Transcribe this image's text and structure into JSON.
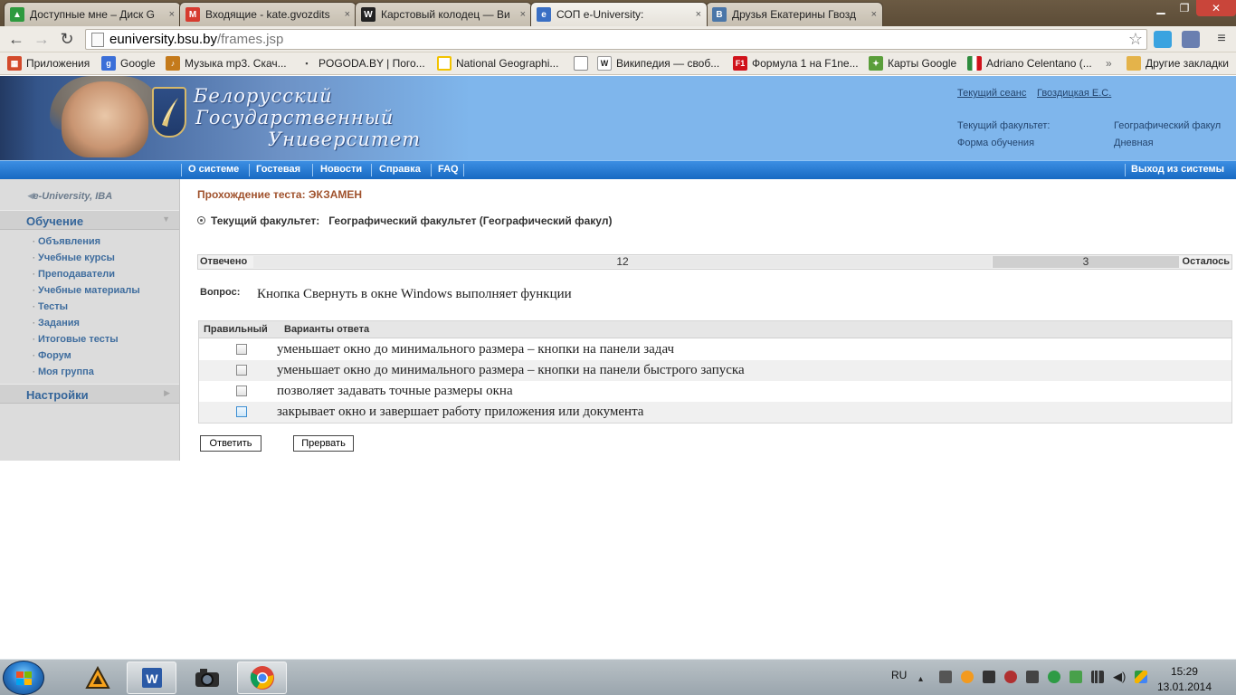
{
  "browser": {
    "tabs": [
      {
        "label": "Доступные мне – Диск G",
        "icon_color": "#2d9a3e",
        "icon": "drive-icon",
        "active": false
      },
      {
        "label": "Входящие - kate.gvozdits",
        "icon_color": "#d63b2f",
        "icon": "gmail-icon",
        "active": false
      },
      {
        "label": "Карстовый колодец — Ви",
        "icon_color": "#222222",
        "icon": "wikipedia-icon",
        "active": false
      },
      {
        "label": "СОП e-University:",
        "icon_color": "#3a6fc4",
        "icon": "euniversity-icon",
        "active": true
      },
      {
        "label": "Друзья Екатерины Гвозд",
        "icon_color": "#4a76a8",
        "icon": "vk-icon",
        "active": false
      }
    ],
    "url_host": "euniversity.bsu.by",
    "url_path": "/frames.jsp",
    "bookmarks": [
      {
        "label": "Приложения",
        "icon": "apps-icon",
        "color": "#d34a2b"
      },
      {
        "label": "Google",
        "icon": "google-icon",
        "color": "#3b6fd8"
      },
      {
        "label": "Музыка mp3. Скач...",
        "icon": "music-icon",
        "color": "#c47a1b"
      },
      {
        "label": "POGODA.BY | Пого...",
        "icon": "weather-icon",
        "color": "#444444"
      },
      {
        "label": "National Geographi...",
        "icon": "natgeo-icon",
        "color": "#f2c300"
      },
      {
        "label": "",
        "icon": "page-icon",
        "color": "#888888"
      },
      {
        "label": "Википедия — своб...",
        "icon": "wikipedia-icon",
        "color": "#222222"
      },
      {
        "label": "Формула 1 на F1ne...",
        "icon": "f1-icon",
        "color": "#d0121b"
      },
      {
        "label": "Карты Google",
        "icon": "maps-icon",
        "color": "#5a9e3a"
      },
      {
        "label": "Adriano Celentano (...",
        "icon": "italy-flag-icon",
        "color": "#2e8b3d"
      },
      {
        "label": "»",
        "icon": "more-icon",
        "color": ""
      },
      {
        "label": "Другие закладки",
        "icon": "folder-icon",
        "color": "#e4b34a"
      }
    ]
  },
  "header": {
    "uni_line1": "Белорусский",
    "uni_line2": "Государственный",
    "uni_line3": "Университет",
    "session_label": "Текущий сеанс",
    "session_user": "Гвоздицкая Е.С.",
    "faculty_label": "Текущий факультет:",
    "faculty_value": "Географический факул",
    "form_label": "Форма обучения",
    "form_value": "Дневная"
  },
  "nav": {
    "items": [
      "О системе",
      "Гостевая",
      "Новости",
      "Справка",
      "FAQ"
    ],
    "logout": "Выход из системы"
  },
  "sidebar": {
    "logo": "e-University, IBA",
    "section1": "Обучение",
    "items": [
      "Объявления",
      "Учебные курсы",
      "Преподаватели",
      "Учебные материалы",
      "Тесты",
      "Задания",
      "Итоговые тесты",
      "Форум",
      "Моя группа"
    ],
    "section2": "Настройки"
  },
  "main": {
    "title": "Прохождение теста: ЭКЗАМЕН",
    "faculty_label": "Текущий факультет:",
    "faculty_value": "Географический факультет (Географический факул)",
    "progress": {
      "answered_label": "Отвечено",
      "answered": "12",
      "remaining": "3",
      "remaining_label": "Осталось",
      "fraction_answered": 0.8
    },
    "question_label": "Вопрос:",
    "question_text": "Кнопка Свернуть в окне Windows выполняет функции",
    "col_correct": "Правильный",
    "col_options": "Варианты ответа",
    "answers": [
      {
        "text": "уменьшает окно до минимального размера – кнопки на панели задач",
        "checked": false
      },
      {
        "text": "уменьшает окно до минимального размера – кнопки на панели быстрого запуска",
        "checked": false
      },
      {
        "text": "позволяет задавать точные размеры окна",
        "checked": false
      },
      {
        "text": "закрывает окно и завершает работу приложения или документа",
        "checked": false
      }
    ],
    "submit_label": "Ответить",
    "abort_label": "Прервать"
  },
  "taskbar": {
    "lang": "RU",
    "time": "15:29",
    "date": "13.01.2014"
  }
}
